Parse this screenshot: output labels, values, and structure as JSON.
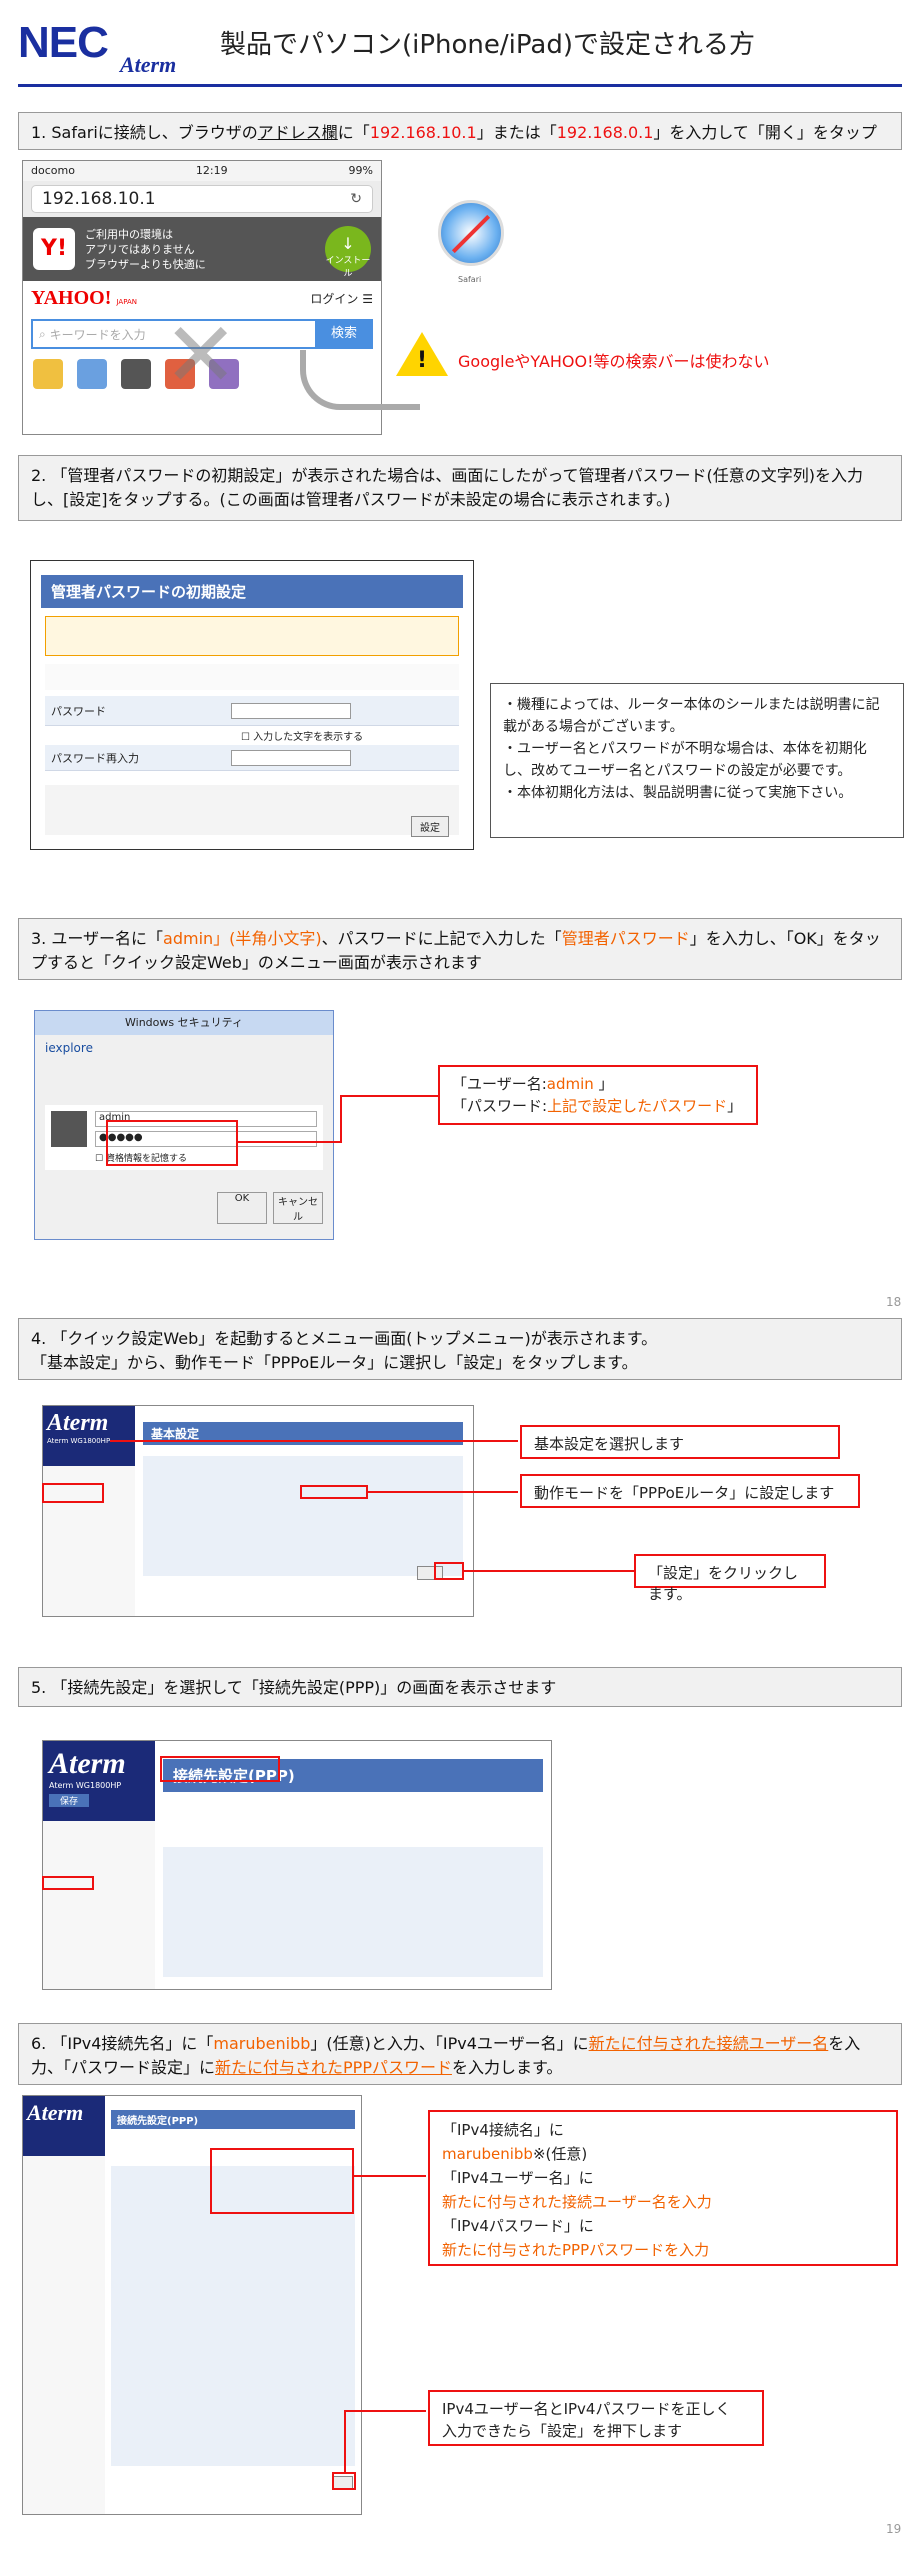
{
  "header": {
    "logo": "NEC",
    "logo_sub": "Aterm",
    "title": "製品でパソコン(iPhone/iPad)で設定される方"
  },
  "step1": {
    "prefix": "1. Safariに接続し、ブラウザの",
    "address_bar": "アドレス欄",
    "mid1": "に「",
    "ip1": "192.168.10.1",
    "mid2": "」または「",
    "ip2": "192.168.0.1",
    "suffix": "」を入力して「開く」をタップ",
    "phone_carrier": "docomo",
    "phone_time": "12:19",
    "phone_battery": "99%",
    "address_value": "192.168.10.1",
    "banner_line1": "ご利用中の環境は",
    "banner_line2": "アプリではありません",
    "banner_line3": "ブラウザーよりも快適に",
    "install_label": "インストール",
    "yahoo_logo": "YAHOO!",
    "yahoo_japan": "JAPAN",
    "login_label": "ログイン",
    "search_placeholder": "キーワードを入力",
    "search_button": "検索",
    "warning": "GoogleやYAHOO!等の検索バーは使わない",
    "safari_label": "Safari"
  },
  "step2": {
    "text": "2. 「管理者パスワードの初期設定」が表示された場合は、画面にしたがって管理者パスワード(任意の文字列)を入力し、[設定]をタップする。(この画面は管理者パスワードが未設定の場合に表示されます。)",
    "screen_title": "管理者パスワードの初期設定",
    "password_label": "パスワード",
    "password_confirm_label": "パスワード再入力",
    "show_chars": "入力した文字を表示する",
    "set_button": "設定",
    "note_line1": "・機種によっては、ルーター本体のシールまたは説明書に記載がある場合がございます。",
    "note_line2": "・ユーザー名とパスワードが不明な場合は、本体を初期化し、改めてユーザー名とパスワードの設定が必要です。",
    "note_line3": "・本体初期化方法は、製品説明書に従って実施下さい。"
  },
  "step3": {
    "prefix": "3. ユーザー名に「",
    "admin": "admin」(半角小文字)",
    "mid": "、パスワードに上記で入力した「",
    "admin_pw": "管理者パスワード",
    "suffix": "」を入力し、「OK」をタップすると「クイック設定Web」のメニュー画面が表示されます",
    "dialog_title": "Windows セキュリティ",
    "dialog_app": "iexplore",
    "username_value": "admin",
    "password_value": "●●●●●",
    "remember": "資格情報を記憶する",
    "ok": "OK",
    "cancel": "キャンセル",
    "callout_user_prefix": "「ユーザー名:",
    "callout_user_value": "admin",
    "callout_user_suffix": " 」",
    "callout_pw_prefix": "「パスワード:",
    "callout_pw_value": "上記で設定したパスワード",
    "callout_pw_suffix": "」",
    "page_number": "18"
  },
  "step4": {
    "text_line1": "4. 「クイック設定Web」を起動するとメニュー画面(トップメニュー)が表示されます。",
    "text_line2": "「基本設定」から、動作モード「PPPoEルータ」に選択し「設定」をタップします。",
    "aterm_logo": "Aterm",
    "model": "Aterm WG1800HP",
    "screen_title": "基本設定",
    "callout1": "基本設定を選択します",
    "callout2": "動作モードを「PPPoEルータ」に設定します",
    "callout3": "「設定」をクリックします。"
  },
  "step5": {
    "text": "5. 「接続先設定」を選択して「接続先設定(PPP)」の画面を表示させます",
    "aterm_logo": "Aterm",
    "model": "Aterm WG1800HP",
    "screen_title": "接続先設定(PPP)",
    "save": "保存"
  },
  "step6": {
    "p1": "6. 「IPv4接続先名」に「",
    "name": "marubenibb",
    "p2": "」(任意)と入力、「IPv4ユーザー名」に",
    "user": "新たに付与された接続ユーザー名",
    "p3": "を入力、「パスワード設定」に",
    "pw": "新たに付与されたPPPパスワード",
    "p4": "を入力します。",
    "aterm_logo": "Aterm",
    "screen_title": "接続先設定(PPP)",
    "c1_l1": "「IPv4接続名」に",
    "c1_l2_val": "marubenibb",
    "c1_l2_suf": "※(任意)",
    "c1_l3": "「IPv4ユーザー名」に",
    "c1_l4": "新たに付与された接続ユーザー名を入力",
    "c1_l5": "「IPv4パスワード」に",
    "c1_l6": "新たに付与されたPPPパスワードを入力",
    "c2_l1": "IPv4ユーザー名とIPv4パスワードを正しく",
    "c2_l2": "入力できたら「設定」を押下します",
    "page_number": "19"
  },
  "colors": {
    "brand": "#1a2fa0",
    "highlight_red": "#e11111",
    "highlight_orange": "#f26200",
    "aterm_navy": "#1b2a78"
  }
}
